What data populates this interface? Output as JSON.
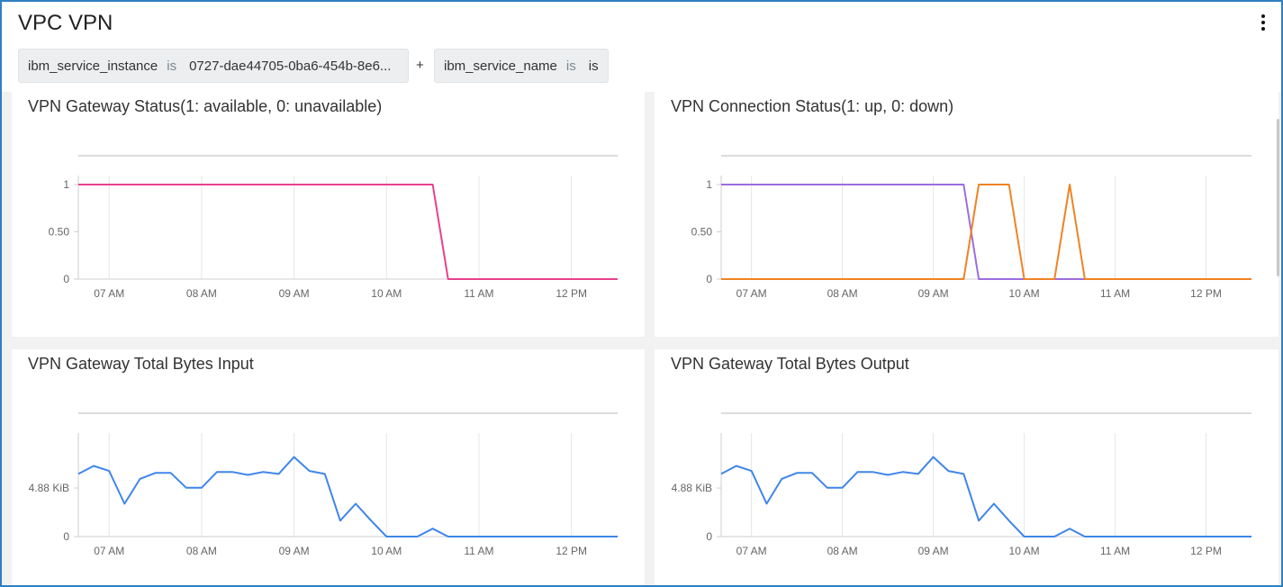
{
  "header": {
    "title": "VPC VPN",
    "filters": [
      {
        "key": "ibm_service_instance",
        "op": "is",
        "value": "0727-dae44705-0ba6-454b-8e6..."
      },
      {
        "key": "ibm_service_name",
        "op": "is",
        "value": "is"
      }
    ],
    "plus": "+"
  },
  "chart_data": [
    {
      "type": "line",
      "title": "VPN Gateway Status(1: available, 0: unavailable)",
      "x_ticks": [
        "07 AM",
        "08 AM",
        "09 AM",
        "10 AM",
        "11 AM",
        "12 PM"
      ],
      "y_ticks": [
        "0",
        "0.50",
        "1"
      ],
      "ylim": [
        0,
        1
      ],
      "xlim": [
        "06:40",
        "12:30"
      ],
      "series": [
        {
          "color": "#e8418c",
          "points": [
            [
              "06:40",
              1
            ],
            [
              "10:30",
              1
            ],
            [
              "10:40",
              0
            ],
            [
              "12:30",
              0
            ]
          ]
        }
      ]
    },
    {
      "type": "line",
      "title": "VPN Connection Status(1: up, 0: down)",
      "x_ticks": [
        "07 AM",
        "08 AM",
        "09 AM",
        "10 AM",
        "11 AM",
        "12 PM"
      ],
      "y_ticks": [
        "0",
        "0.50",
        "1"
      ],
      "ylim": [
        0,
        1
      ],
      "xlim": [
        "06:40",
        "12:30"
      ],
      "series": [
        {
          "color": "#9c6ddf",
          "points": [
            [
              "06:40",
              1
            ],
            [
              "09:20",
              1
            ],
            [
              "09:30",
              0
            ],
            [
              "12:30",
              0
            ]
          ]
        },
        {
          "color": "#f08223",
          "points": [
            [
              "06:40",
              0
            ],
            [
              "09:20",
              0
            ],
            [
              "09:30",
              1
            ],
            [
              "09:50",
              1
            ],
            [
              "10:00",
              0
            ],
            [
              "10:20",
              0
            ],
            [
              "10:30",
              1
            ],
            [
              "10:40",
              0
            ],
            [
              "12:30",
              0
            ]
          ]
        }
      ]
    },
    {
      "type": "line",
      "title": "VPN Gateway Total Bytes Input",
      "x_ticks": [
        "07 AM",
        "08 AM",
        "09 AM",
        "10 AM",
        "11 AM",
        "12 PM"
      ],
      "y_ticks": [
        "0",
        "4.88 KiB"
      ],
      "ylim": [
        0,
        9.5
      ],
      "xlim": [
        "06:40",
        "12:30"
      ],
      "series": [
        {
          "color": "#3f86ea",
          "points": [
            [
              "06:40",
              6.3
            ],
            [
              "06:50",
              7.1
            ],
            [
              "07:00",
              6.6
            ],
            [
              "07:10",
              3.3
            ],
            [
              "07:20",
              5.8
            ],
            [
              "07:30",
              6.4
            ],
            [
              "07:40",
              6.4
            ],
            [
              "07:50",
              4.9
            ],
            [
              "08:00",
              4.9
            ],
            [
              "08:10",
              6.5
            ],
            [
              "08:20",
              6.5
            ],
            [
              "08:30",
              6.2
            ],
            [
              "08:40",
              6.5
            ],
            [
              "08:50",
              6.3
            ],
            [
              "09:00",
              8.0
            ],
            [
              "09:10",
              6.6
            ],
            [
              "09:20",
              6.3
            ],
            [
              "09:30",
              1.6
            ],
            [
              "09:40",
              3.3
            ],
            [
              "09:50",
              1.6
            ],
            [
              "10:00",
              0
            ],
            [
              "10:10",
              0
            ],
            [
              "10:20",
              0
            ],
            [
              "10:30",
              0.8
            ],
            [
              "10:40",
              0
            ],
            [
              "12:30",
              0
            ]
          ]
        }
      ]
    },
    {
      "type": "line",
      "title": "VPN Gateway Total Bytes Output",
      "x_ticks": [
        "07 AM",
        "08 AM",
        "09 AM",
        "10 AM",
        "11 AM",
        "12 PM"
      ],
      "y_ticks": [
        "0",
        "4.88 KiB"
      ],
      "ylim": [
        0,
        9.5
      ],
      "xlim": [
        "06:40",
        "12:30"
      ],
      "series": [
        {
          "color": "#3f86ea",
          "points": [
            [
              "06:40",
              6.3
            ],
            [
              "06:50",
              7.1
            ],
            [
              "07:00",
              6.6
            ],
            [
              "07:10",
              3.3
            ],
            [
              "07:20",
              5.8
            ],
            [
              "07:30",
              6.4
            ],
            [
              "07:40",
              6.4
            ],
            [
              "07:50",
              4.9
            ],
            [
              "08:00",
              4.9
            ],
            [
              "08:10",
              6.5
            ],
            [
              "08:20",
              6.5
            ],
            [
              "08:30",
              6.2
            ],
            [
              "08:40",
              6.5
            ],
            [
              "08:50",
              6.3
            ],
            [
              "09:00",
              8.0
            ],
            [
              "09:10",
              6.6
            ],
            [
              "09:20",
              6.3
            ],
            [
              "09:30",
              1.6
            ],
            [
              "09:40",
              3.3
            ],
            [
              "09:50",
              1.6
            ],
            [
              "10:00",
              0
            ],
            [
              "10:10",
              0
            ],
            [
              "10:20",
              0
            ],
            [
              "10:30",
              0.8
            ],
            [
              "10:40",
              0
            ],
            [
              "12:30",
              0
            ]
          ]
        }
      ]
    }
  ]
}
